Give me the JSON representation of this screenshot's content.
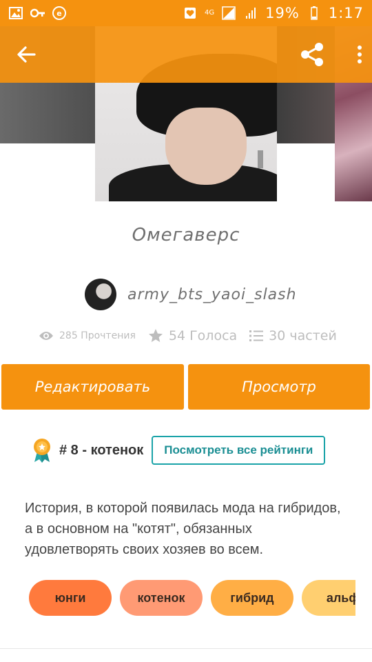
{
  "status_bar": {
    "network": "4G",
    "battery": "19%",
    "time": "1:17"
  },
  "toolbar": {
    "back_icon": "arrow-left-icon",
    "share_icon": "share-icon",
    "more_icon": "more-vertical-icon"
  },
  "story": {
    "title": "Омегаверс",
    "author": "army_bts_yaoi_slash",
    "reads": "285 Прочтения",
    "votes": "54 Голоса",
    "parts": "30 частей",
    "description": "История, в которой появилась мода на гибридов, а в основном на \"котят\", обязанных удовлетворять своих хозяев во всем."
  },
  "actions": {
    "edit_label": "Редактировать",
    "view_label": "Просмотр"
  },
  "ranking": {
    "text": "# 8 - котенок",
    "button_label": "Посмотреть все рейтинги"
  },
  "tags": [
    "юнги",
    "котенок",
    "гибрид",
    "альф"
  ],
  "colors": {
    "accent": "#f5920f",
    "teal": "#1aa3a8"
  }
}
